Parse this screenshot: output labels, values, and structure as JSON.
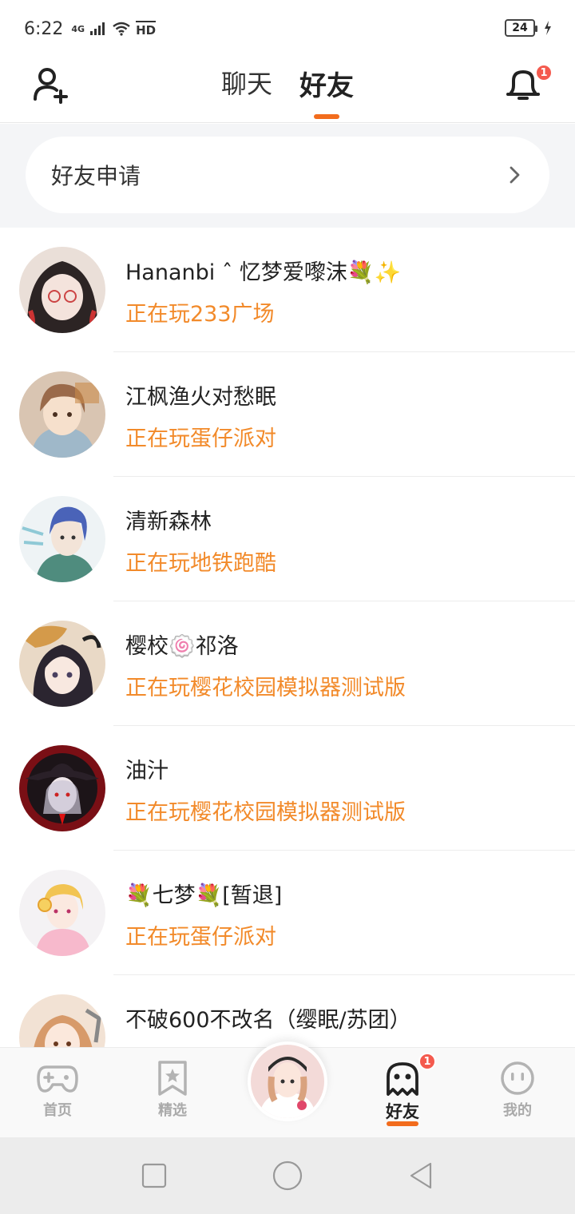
{
  "status_bar": {
    "time": "6:22",
    "network": "4G",
    "hd": "HD",
    "battery": "24"
  },
  "header": {
    "tabs": [
      {
        "label": "聊天",
        "active": false
      },
      {
        "label": "好友",
        "active": true
      }
    ],
    "notification_count": "1",
    "accent_color": "#f26c1d"
  },
  "friend_request": {
    "label": "好友申请"
  },
  "friends": [
    {
      "name": "Hananbi ˆ 忆梦爱嚟沫💐✨",
      "status": "正在玩233广场"
    },
    {
      "name": "江枫渔火对愁眠",
      "status": "正在玩蛋仔派对"
    },
    {
      "name": "清新森林",
      "status": "正在玩地铁跑酷"
    },
    {
      "name": "樱校🍥祁洛",
      "status": "正在玩樱花校园模拟器测试版"
    },
    {
      "name": "油汁",
      "status": "正在玩樱花校园模拟器测试版"
    },
    {
      "name": "💐七梦💐[暂退]",
      "status": "正在玩蛋仔派对"
    },
    {
      "name": "不破600不改名（缨眠/苏团）",
      "status": ""
    }
  ],
  "bottom_nav": {
    "items": [
      {
        "label": "首页",
        "icon": "gamepad-icon"
      },
      {
        "label": "精选",
        "icon": "star-bookmark-icon"
      },
      {
        "label": "好友",
        "icon": "ghost-icon",
        "badge": "1"
      },
      {
        "label": "我的",
        "icon": "face-icon"
      }
    ]
  },
  "status_color": "#f28a2a"
}
